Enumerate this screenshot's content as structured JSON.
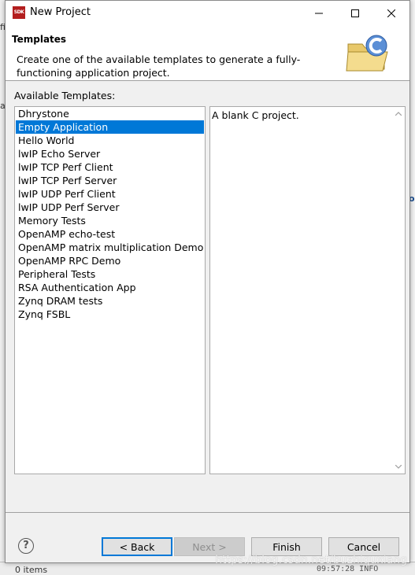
{
  "window": {
    "title": "New Project",
    "app_icon_text": "SDK"
  },
  "header": {
    "title": "Templates",
    "description": "Create one of the available templates to generate a fully-functioning application project.",
    "icon": "c-project-folder-icon"
  },
  "templates": {
    "label": "Available Templates:",
    "selected": "Empty Application",
    "items": [
      "Dhrystone",
      "Empty Application",
      "Hello World",
      "lwIP Echo Server",
      "lwIP TCP Perf Client",
      "lwIP TCP Perf Server",
      "lwIP UDP Perf Client",
      "lwIP UDP Perf Server",
      "Memory Tests",
      "OpenAMP echo-test",
      "OpenAMP matrix multiplication Demo",
      "OpenAMP RPC Demo",
      "Peripheral Tests",
      "RSA Authentication App",
      "Zynq DRAM tests",
      "Zynq FSBL"
    ]
  },
  "description_panel": {
    "text": "A blank C project."
  },
  "buttons": {
    "back": "< Back",
    "next": "Next >",
    "finish": "Finish",
    "cancel": "Cancel"
  },
  "background": {
    "left_fragments": [
      "fi",
      "a"
    ],
    "right_fragment": "o",
    "bottom_left": "0 items",
    "bottom_right": "09:57:28 INFO"
  },
  "watermark": "https://blog.csdn.net/buzhiquxiang",
  "colors": {
    "selection": "#0078d7",
    "default_button_border": "#0078d7"
  }
}
